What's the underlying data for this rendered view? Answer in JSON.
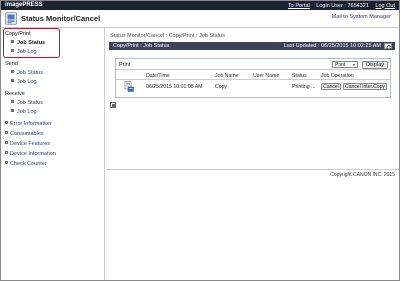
{
  "topbar": {
    "brand": "imagePRESS",
    "portal_link": "To Portal",
    "login_user": "Login User : 7654321",
    "logout_link": "Log Out"
  },
  "header": {
    "title": "Status Monitor/Cancel",
    "mail_link": "Mail to System Manager"
  },
  "sidebar": {
    "groups": [
      {
        "label": "Copy/Print",
        "items": [
          "Job Status",
          "Job Log"
        ]
      },
      {
        "label": "Send",
        "items": [
          "Job Status",
          "Job Log"
        ]
      },
      {
        "label": "Receive",
        "items": [
          "Job Status",
          "Job Log"
        ]
      }
    ],
    "links": [
      "Error Information",
      "Consumables",
      "Device Features",
      "Device Information",
      "Check Counter"
    ],
    "active": "Copy/Print > Job Status"
  },
  "main": {
    "breadcrumb": "Status Monitor/Cancel : Copy/Print : Job Status",
    "panel_title": "Copy/Print : Job Status",
    "last_updated": "Last Updated : 06/25/2015 10:02:25 AM",
    "filter_value": "Print",
    "display_button": "Display",
    "box_label": "Print",
    "columns": [
      "Date/Time",
      "Job Name",
      "User Name",
      "Status",
      "Job Operation"
    ],
    "rows": [
      {
        "datetime": "06/25/2015 10:01:08 AM",
        "job_name": "Copy",
        "user_name": "",
        "status": "Printing ...",
        "cancel": "Cancel",
        "cancel_interrupt": "Cancel Inter.Copy"
      }
    ]
  },
  "footer": {
    "copyright": "Copyright CANON INC. 2015"
  },
  "icons": {
    "refresh": "refresh-icon",
    "logo": "status-monitor-logo-icon",
    "job": "print-job-icon",
    "small": "page-icon"
  },
  "colors": {
    "topbar": "#1a2233",
    "panel_bar": "#3b4456",
    "highlight": "#e0002a",
    "link": "#2a3f8a"
  }
}
